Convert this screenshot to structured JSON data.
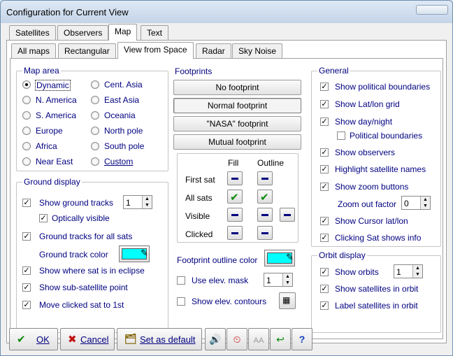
{
  "window": {
    "title": "Configuration for Current View"
  },
  "tabs_top": [
    "Satellites",
    "Observers",
    "Map",
    "Text"
  ],
  "tabs_sub": [
    "All maps",
    "Rectangular",
    "View from Space",
    "Radar",
    "Sky Noise"
  ],
  "map_area": {
    "title": "Map area",
    "options": [
      "Dynamic",
      "N. America",
      "S. America",
      "Europe",
      "Africa",
      "Near East",
      "Cent. Asia",
      "East Asia",
      "Oceania",
      "North pole",
      "South pole",
      "Custom"
    ]
  },
  "ground_display": {
    "title": "Ground display",
    "show_ground_tracks": "Show ground tracks",
    "ground_tracks_value": "1",
    "optically_visible": "Optically visible",
    "ground_tracks_all": "Ground tracks for all sats",
    "ground_track_color": "Ground track color",
    "show_eclipse": "Show where sat is in eclipse",
    "show_subsat": "Show sub-satellite point",
    "move_clicked": "Move clicked sat to 1st"
  },
  "footprints": {
    "title": "Footprints",
    "buttons": [
      "No footprint",
      "Normal footprint",
      "\"NASA\" footprint",
      "Mutual footprint"
    ],
    "col_fill": "Fill",
    "col_outline": "Outline",
    "rows": [
      "First sat",
      "All sats",
      "Visible",
      "Clicked"
    ],
    "outline_color": "Footprint outline color",
    "use_elev_mask": "Use elev. mask",
    "elev_value": "1",
    "show_elev_contours": "Show elev. contours"
  },
  "general": {
    "title": "General",
    "items": [
      "Show political boundaries",
      "Show Lat/lon grid",
      "Show day/night",
      "Political boundaries",
      "Show observers",
      "Highlight satellite names",
      "Show zoom buttons"
    ],
    "zoom_out_factor": "Zoom out factor",
    "zoom_value": "0",
    "cursor_latlon": "Show Cursor lat/lon",
    "clicking_info": "Clicking Sat shows info"
  },
  "orbit_display": {
    "title": "Orbit display",
    "show_orbits": "Show orbits",
    "orbits_value": "1",
    "show_sats_in_orbit": "Show satellites in orbit",
    "label_sats_in_orbit": "Label satellites in orbit"
  },
  "bottom": {
    "ok": "OK",
    "cancel": "Cancel",
    "set_default": "Set as default"
  },
  "colors": {
    "swatch": "#00ffff",
    "label": "#000080",
    "check_green": "#0a8a0a"
  }
}
